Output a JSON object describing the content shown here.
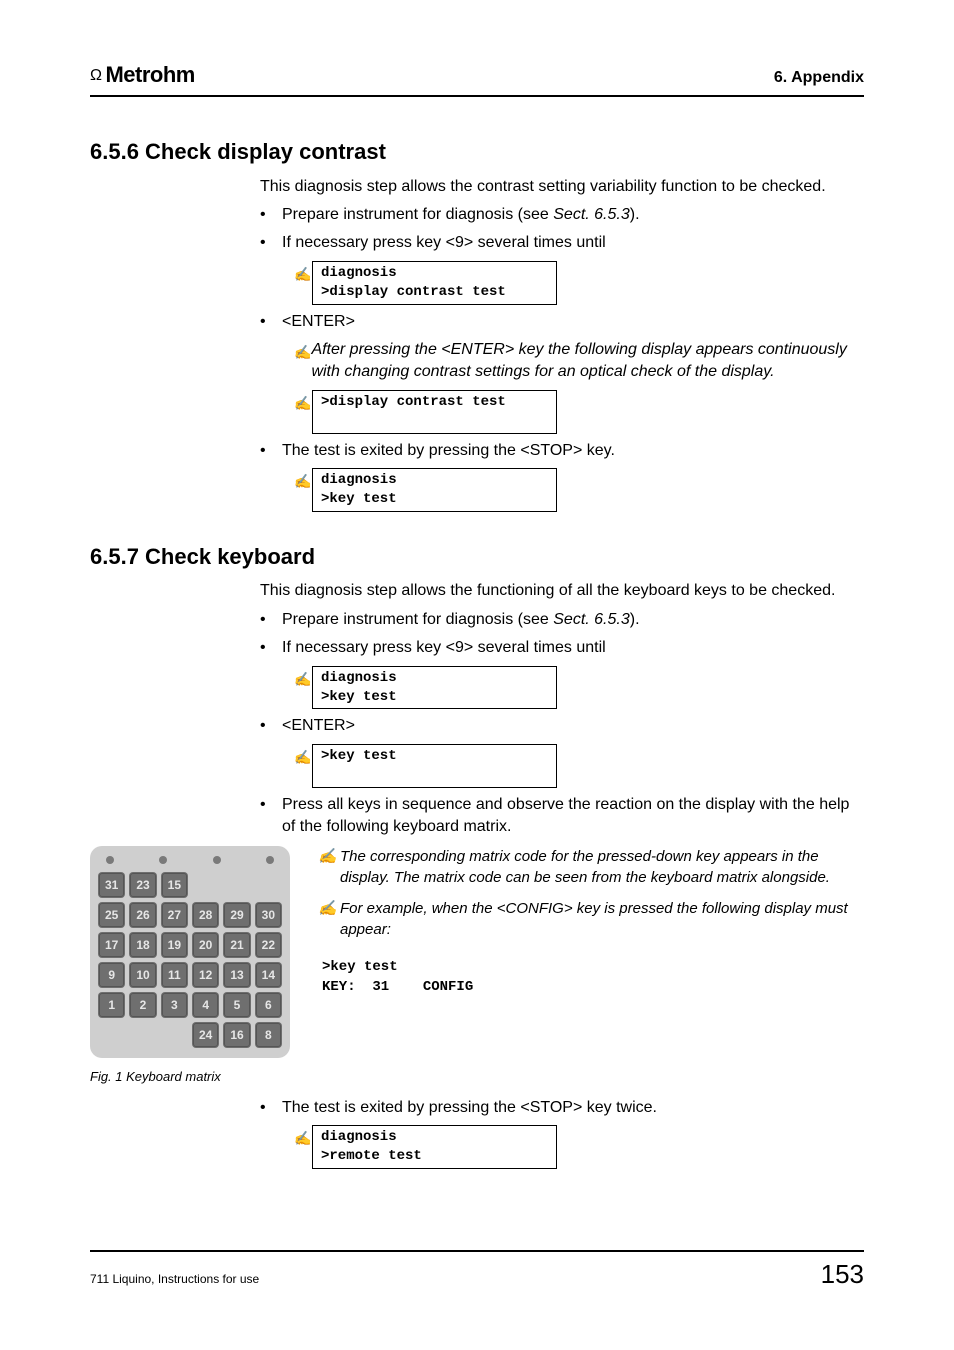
{
  "header": {
    "brand": "Metrohm",
    "section": "6. Appendix"
  },
  "s656": {
    "title": "6.5.6  Check display contrast",
    "intro": "This diagnosis step allows the contrast setting variability function to be checked.",
    "b1a": "Prepare instrument for diagnosis (see ",
    "b1ref": "Sect. 6.5.3",
    "b1b": ").",
    "b2": "If necessary press key <9> several times until",
    "disp1": "diagnosis\n>display contrast test",
    "b3": "<ENTER>",
    "note": "After pressing the <ENTER> key the following display appears continuously with changing contrast settings for an optical check of the display.",
    "disp2": ">display contrast test\n ",
    "b4": "The test is exited by pressing the <STOP> key.",
    "disp3": "diagnosis\n>key test"
  },
  "s657": {
    "title": "6.5.7  Check keyboard",
    "intro": "This diagnosis step allows the functioning of all the keyboard keys to be checked.",
    "b1a": "Prepare instrument for diagnosis (see ",
    "b1ref": "Sect. 6.5.3",
    "b1b": ").",
    "b2": "If necessary press key <9> several times until",
    "disp1": "diagnosis\n>key test",
    "b3": "<ENTER>",
    "disp2": ">key test\n ",
    "b4": "Press all keys in sequence and observe the reaction on the display with the help of the following keyboard matrix.",
    "note1": "The corresponding matrix code for the pressed-down key appears in the display. The matrix code can be seen from the keyboard matrix alongside.",
    "note2": "For example, when the <CONFIG> key is pressed the following display must appear:",
    "mono": ">key test\nKEY:  31    CONFIG",
    "b5": "The test is exited by pressing the <STOP> key twice.",
    "disp3": "diagnosis\n>remote test",
    "fig_caption": "Fig. 1     Keyboard matrix"
  },
  "keypad_rows": [
    [
      "31",
      "23",
      "15",
      "",
      "",
      ""
    ],
    [
      "25",
      "26",
      "27",
      "28",
      "29",
      "30"
    ],
    [
      "17",
      "18",
      "19",
      "20",
      "21",
      "22"
    ],
    [
      "9",
      "10",
      "11",
      "12",
      "13",
      "14"
    ],
    [
      "1",
      "2",
      "3",
      "4",
      "5",
      "6"
    ],
    [
      "",
      "",
      "",
      "24",
      "16",
      "8"
    ]
  ],
  "footer": {
    "doc_title": "711 Liquino, Instructions for use",
    "page_number": "153"
  }
}
